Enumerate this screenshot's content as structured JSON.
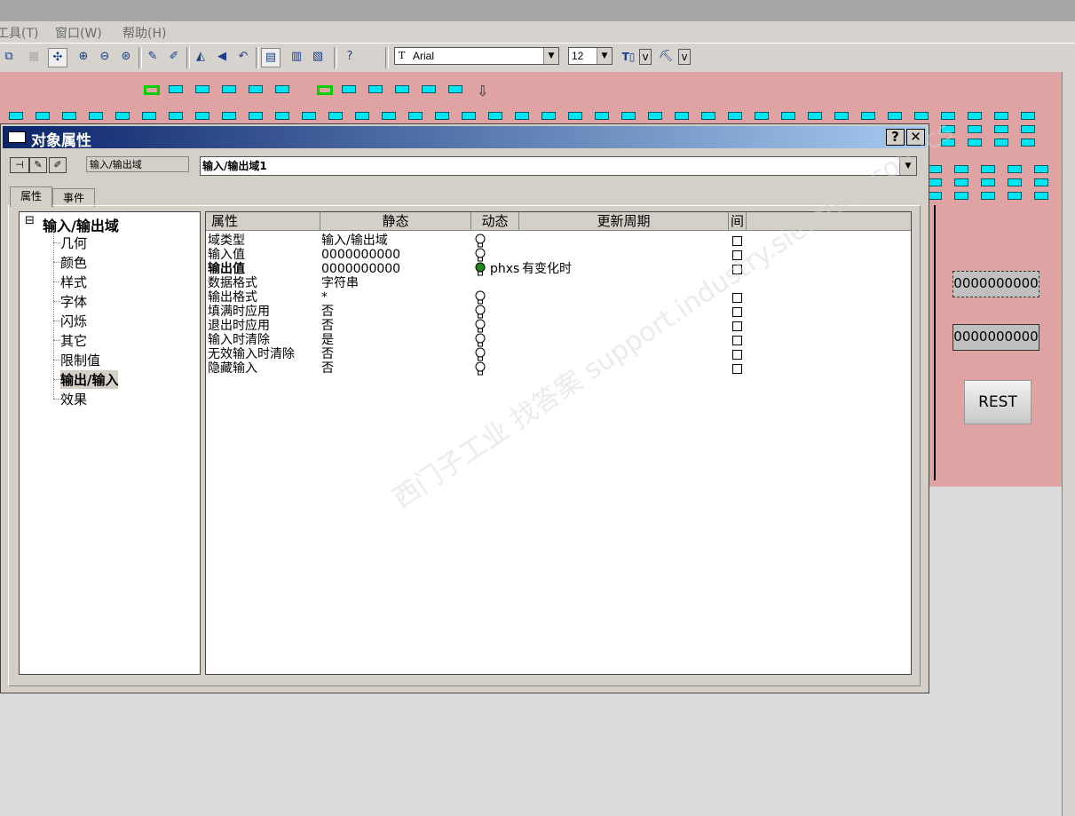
{
  "menu": [
    {
      "label": "工具(T)"
    },
    {
      "label": "窗口(W)"
    },
    {
      "label": "帮助(H)"
    }
  ],
  "toolbar": {
    "font_name": "Arial",
    "font_size": "12",
    "font_icon": "Tr",
    "color_icon_a": "v",
    "color_icon_b": "v"
  },
  "canvas": {
    "io_field_1": "0000000000",
    "io_field_2": "0000000000",
    "rest_button": "REST"
  },
  "dialog": {
    "title": "对象属性",
    "help_btn": "?",
    "close_btn": "✕",
    "object_type": "输入/输出域",
    "object_name": "输入/输出域1",
    "tabs": [
      {
        "label": "属性"
      },
      {
        "label": "事件"
      }
    ],
    "tree": {
      "root": "输入/输出域",
      "items": [
        {
          "label": "几何"
        },
        {
          "label": "颜色"
        },
        {
          "label": "样式"
        },
        {
          "label": "字体"
        },
        {
          "label": "闪烁"
        },
        {
          "label": "其它"
        },
        {
          "label": "限制值"
        },
        {
          "label": "输出/输入"
        },
        {
          "label": "效果"
        }
      ]
    },
    "columns": {
      "attr": "属性",
      "static": "静态",
      "dynamic": "动态",
      "update": "更新周期",
      "indirect": "间"
    },
    "rows": [
      {
        "attr": "域类型",
        "static": "输入/输出域",
        "dynamic": "",
        "bulb": "off"
      },
      {
        "attr": "输入值",
        "static": "0000000000",
        "dynamic": "",
        "bulb": "off"
      },
      {
        "attr": "输出值",
        "static": "0000000000",
        "dynamic": "phxs",
        "update": "有变化时",
        "bulb": "on"
      },
      {
        "attr": "数据格式",
        "static": "字符串",
        "dynamic": "",
        "bulb": "none"
      },
      {
        "attr": "输出格式",
        "static": "*",
        "dynamic": "",
        "bulb": "off"
      },
      {
        "attr": "填满时应用",
        "static": "否",
        "dynamic": "",
        "bulb": "off"
      },
      {
        "attr": "退出时应用",
        "static": "否",
        "dynamic": "",
        "bulb": "off"
      },
      {
        "attr": "输入时清除",
        "static": "是",
        "dynamic": "",
        "bulb": "off"
      },
      {
        "attr": "无效输入时清除",
        "static": "否",
        "dynamic": "",
        "bulb": "off"
      },
      {
        "attr": "隐藏输入",
        "static": "否",
        "dynamic": "",
        "bulb": "off"
      }
    ]
  },
  "watermark": "西门子工业  找答案  support.industry.siemens.com/cs",
  "colors": {
    "canvas_bg": "#e0a3a3",
    "titlebar": "#0a246a",
    "io_cyan": "#00e5f2"
  }
}
